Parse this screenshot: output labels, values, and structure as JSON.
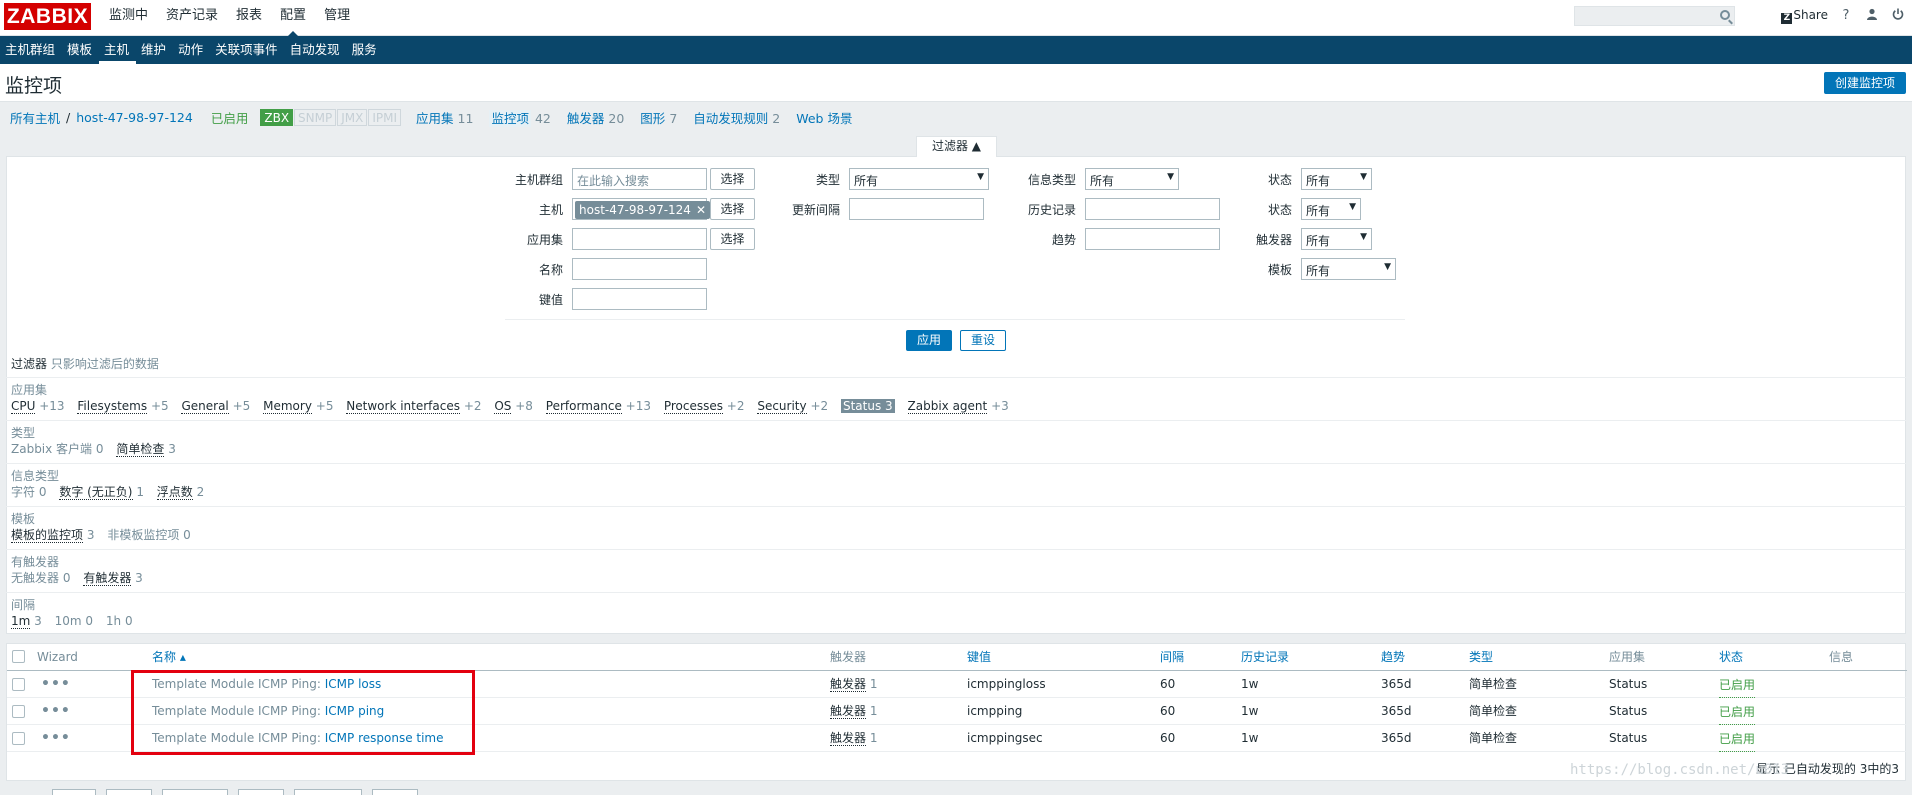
{
  "logo": "ZABBIX",
  "main_menu": [
    "监测中",
    "资产记录",
    "报表",
    "配置",
    "管理"
  ],
  "main_menu_selected": 3,
  "top_right": {
    "share": "Share",
    "help": "?",
    "user": "user-icon",
    "logout": "power-icon"
  },
  "sub_menu": [
    "主机群组",
    "模板",
    "主机",
    "维护",
    "动作",
    "关联项事件",
    "自动发现",
    "服务"
  ],
  "sub_menu_selected": 2,
  "page_title": "监控项",
  "create_button": "创建监控项",
  "nav": {
    "all_hosts": "所有主机",
    "separator": "/",
    "host": "host-47-98-97-124",
    "status": "已启用",
    "badges": [
      {
        "label": "ZBX",
        "active": true
      },
      {
        "label": "SNMP",
        "active": false
      },
      {
        "label": "JMX",
        "active": false
      },
      {
        "label": "IPMI",
        "active": false
      }
    ],
    "items": [
      {
        "label": "应用集",
        "count": "11"
      },
      {
        "label": "监控项",
        "count": "42"
      },
      {
        "label": "触发器",
        "count": "20"
      },
      {
        "label": "图形",
        "count": "7"
      },
      {
        "label": "自动发现规则",
        "count": "2"
      },
      {
        "label": "Web 场景",
        "count": ""
      }
    ]
  },
  "filter": {
    "tab_label": "过滤器 ▲",
    "host_group_label": "主机群组",
    "host_group_placeholder": "在此输入搜索",
    "select_button": "选择",
    "host_label": "主机",
    "host_tag": "host-47-98-97-124",
    "application_label": "应用集",
    "name_label": "名称",
    "key_label": "键值",
    "type_label": "类型",
    "type_value": "所有",
    "interval_label": "更新间隔",
    "info_type_label": "信息类型",
    "info_type_value": "所有",
    "history_label": "历史记录",
    "trends_label": "趋势",
    "state_label": "状态",
    "state_value": "所有",
    "status_label": "状态",
    "status_value": "所有",
    "triggers_label": "触发器",
    "triggers_value": "所有",
    "template_label": "模板",
    "template_value": "所有",
    "apply_button": "应用",
    "reset_button": "重设"
  },
  "subfilter": {
    "title": "过滤器",
    "description": "只影响过滤后的数据",
    "groups": [
      {
        "header": "应用集",
        "values": [
          {
            "label": "CPU",
            "count": "+13"
          },
          {
            "label": "Filesystems",
            "count": "+5"
          },
          {
            "label": "General",
            "count": "+5"
          },
          {
            "label": "Memory",
            "count": "+5"
          },
          {
            "label": "Network interfaces",
            "count": "+2"
          },
          {
            "label": "OS",
            "count": "+8"
          },
          {
            "label": "Performance",
            "count": "+13"
          },
          {
            "label": "Processes",
            "count": "+2"
          },
          {
            "label": "Security",
            "count": "+2"
          },
          {
            "label": "Status",
            "count": "3",
            "selected": true
          },
          {
            "label": "Zabbix agent",
            "count": "+3"
          }
        ]
      },
      {
        "header": "类型",
        "values": [
          {
            "label": "Zabbix 客户端",
            "count": "0",
            "dim": true
          },
          {
            "label": "简单检查",
            "count": "3"
          }
        ]
      },
      {
        "header": "信息类型",
        "values": [
          {
            "label": "字符",
            "count": "0",
            "dim": true
          },
          {
            "label": "数字 (无正负)",
            "count": "1"
          },
          {
            "label": "浮点数",
            "count": "2"
          }
        ]
      },
      {
        "header": "模板",
        "values": [
          {
            "label": "模板的监控项",
            "count": "3"
          },
          {
            "label": "非模板监控项",
            "count": "0",
            "dim": true
          }
        ]
      },
      {
        "header": "有触发器",
        "values": [
          {
            "label": "无触发器",
            "count": "0",
            "dim": true
          },
          {
            "label": "有触发器",
            "count": "3"
          }
        ]
      },
      {
        "header": "间隔",
        "values": [
          {
            "label": "1m",
            "count": "3"
          },
          {
            "label": "10m",
            "count": "0",
            "dim": true
          },
          {
            "label": "1h",
            "count": "0",
            "dim": true
          }
        ]
      }
    ]
  },
  "table": {
    "headers": {
      "wizard": "Wizard",
      "name": "名称 ▴",
      "triggers": "触发器",
      "key": "键值",
      "interval": "间隔",
      "history": "历史记录",
      "trends": "趋势",
      "type": "类型",
      "applications": "应用集",
      "status": "状态",
      "info": "信息"
    },
    "rows": [
      {
        "template": "Template Module ICMP Ping:",
        "name": "ICMP loss",
        "trigger_label": "触发器",
        "trigger_count": "1",
        "key": "icmppingloss",
        "interval": "60",
        "history": "1w",
        "trends": "365d",
        "type": "简单检查",
        "application": "Status",
        "status": "已启用"
      },
      {
        "template": "Template Module ICMP Ping:",
        "name": "ICMP ping",
        "trigger_label": "触发器",
        "trigger_count": "1",
        "key": "icmpping",
        "interval": "60",
        "history": "1w",
        "trends": "365d",
        "type": "简单检查",
        "application": "Status",
        "status": "已启用"
      },
      {
        "template": "Template Module ICMP Ping:",
        "name": "ICMP response time",
        "trigger_label": "触发器",
        "trigger_count": "1",
        "key": "icmppingsec",
        "interval": "60",
        "history": "1w",
        "trends": "365d",
        "type": "简单检查",
        "application": "Status",
        "status": "已启用"
      }
    ],
    "wizard_glyph": "•••",
    "footer": "显示 已自动发现的 3中的3"
  },
  "watermark": "https://blog.csdn.net/u013"
}
